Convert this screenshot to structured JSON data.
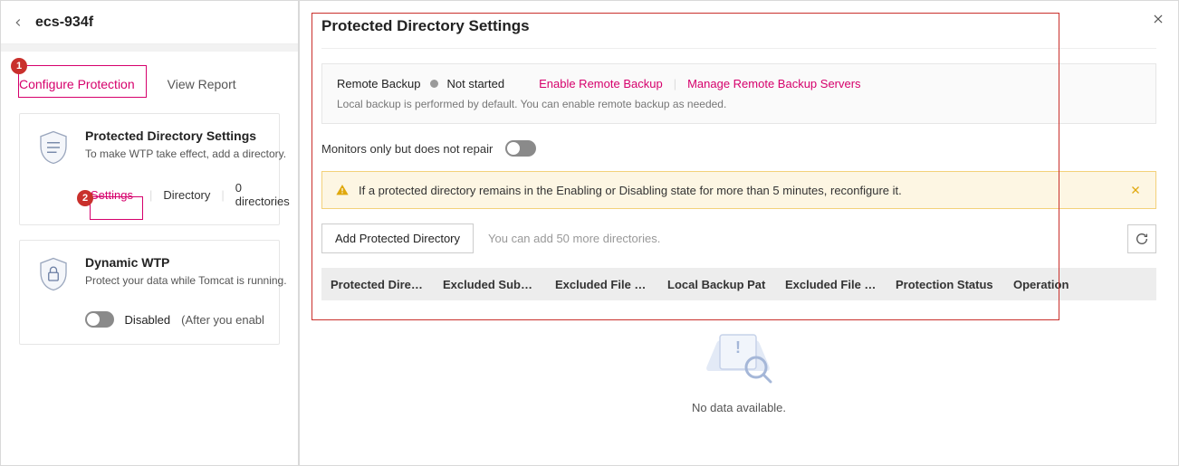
{
  "header": {
    "title": "ecs-934f"
  },
  "tabs": {
    "configure": "Configure Protection",
    "view_report": "View Report"
  },
  "card1": {
    "title": "Protected Directory Settings",
    "sub": "To make WTP take effect, add a directory.",
    "links": {
      "settings": "Settings",
      "directory": "Directory",
      "count": "0 directories"
    }
  },
  "card2": {
    "title": "Dynamic WTP",
    "sub": "Protect your data while Tomcat is running.",
    "toggle_label": "Disabled",
    "toggle_note": "(After you enable"
  },
  "panel": {
    "title": "Protected Directory Settings",
    "remote": {
      "label": "Remote Backup",
      "status": "Not started",
      "enable": "Enable Remote Backup",
      "manage": "Manage Remote Backup Servers",
      "hint": "Local backup is performed by default. You can enable remote backup as needed."
    },
    "monitors": "Monitors only but does not repair",
    "warn": "If a protected directory remains in the Enabling or Disabling state for more than 5 minutes, reconfigure it.",
    "add_btn": "Add Protected Directory",
    "add_hint": "You can add 50 more directories.",
    "columns": {
      "c1": "Protected Direc…",
      "c2": "Excluded Subdi…",
      "c3": "Excluded File T…",
      "c4": "Local Backup Pat",
      "c5": "Excluded File P…",
      "c6": "Protection Status",
      "c7": "Operation"
    },
    "empty": "No data available."
  },
  "annot": {
    "n1": "1",
    "n2": "2"
  }
}
